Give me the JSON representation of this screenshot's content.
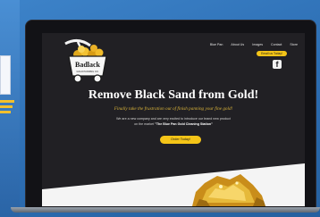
{
  "website": {
    "nav": [
      "Blue Pan",
      "About Us",
      "Images",
      "Contact",
      "Store"
    ],
    "header_cta": "Email us Today!",
    "social_icon": "facebook-icon",
    "logo": {
      "line1": "Badlack",
      "line2": "GOLD PANNING CO.",
      "icons": [
        "pickaxe-icon",
        "gold-cart-icon"
      ]
    },
    "headline": "Remove Black Sand from Gold!",
    "tagline": "Finally take the frustration out of finish panning your fine gold!",
    "intro_line1": "We are a new company and are very excited to introduce our brand new product",
    "intro_line2_prefix": "on the market ",
    "intro_line2_product": "\"The Blue Pan Gold Cleaning Station\"",
    "main_cta": "Order Today!",
    "hero_image": "gold-nugget-image"
  },
  "colors": {
    "page_bg": "#212024",
    "accent_gold": "#f5c518",
    "tagline_gold": "#d8b23a",
    "backdrop_blue": "#2c6db2"
  }
}
